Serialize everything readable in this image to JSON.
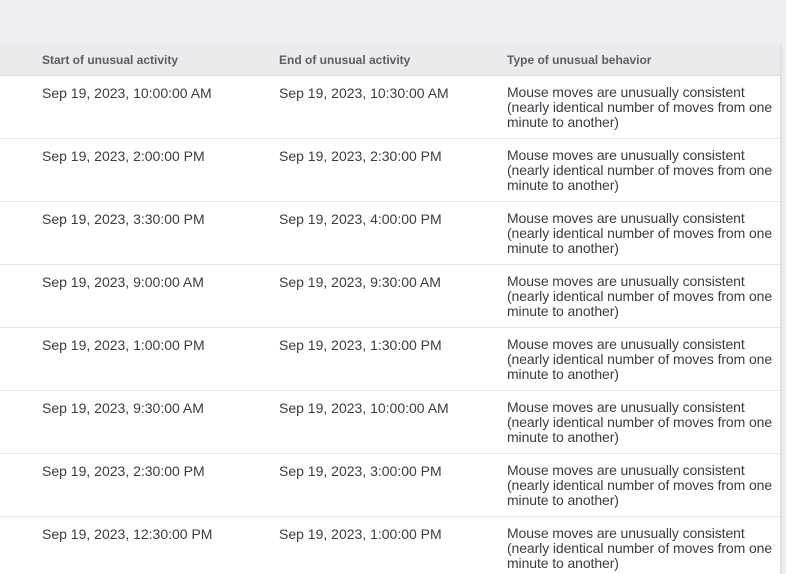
{
  "table": {
    "columns": {
      "start": "Start of unusual activity",
      "end": "End of unusual activity",
      "type": "Type of unusual behavior"
    },
    "rows": [
      {
        "start": "Sep 19, 2023, 10:00:00 AM",
        "end": "Sep 19, 2023, 10:30:00 AM",
        "type": "Mouse moves are unusually consistent (nearly identical number of moves from one minute to another)"
      },
      {
        "start": "Sep 19, 2023, 2:00:00 PM",
        "end": "Sep 19, 2023, 2:30:00 PM",
        "type": "Mouse moves are unusually consistent (nearly identical number of moves from one minute to another)"
      },
      {
        "start": "Sep 19, 2023, 3:30:00 PM",
        "end": "Sep 19, 2023, 4:00:00 PM",
        "type": "Mouse moves are unusually consistent (nearly identical number of moves from one minute to another)"
      },
      {
        "start": "Sep 19, 2023, 9:00:00 AM",
        "end": "Sep 19, 2023, 9:30:00 AM",
        "type": "Mouse moves are unusually consistent (nearly identical number of moves from one minute to another)"
      },
      {
        "start": "Sep 19, 2023, 1:00:00 PM",
        "end": "Sep 19, 2023, 1:30:00 PM",
        "type": "Mouse moves are unusually consistent (nearly identical number of moves from one minute to another)"
      },
      {
        "start": "Sep 19, 2023, 9:30:00 AM",
        "end": "Sep 19, 2023, 10:00:00 AM",
        "type": "Mouse moves are unusually consistent (nearly identical number of moves from one minute to another)"
      },
      {
        "start": "Sep 19, 2023, 2:30:00 PM",
        "end": "Sep 19, 2023, 3:00:00 PM",
        "type": "Mouse moves are unusually consistent (nearly identical number of moves from one minute to another)"
      },
      {
        "start": "Sep 19, 2023, 12:30:00 PM",
        "end": "Sep 19, 2023, 1:00:00 PM",
        "type": "Mouse moves are unusually consistent (nearly identical number of moves from one minute to another)"
      }
    ]
  }
}
